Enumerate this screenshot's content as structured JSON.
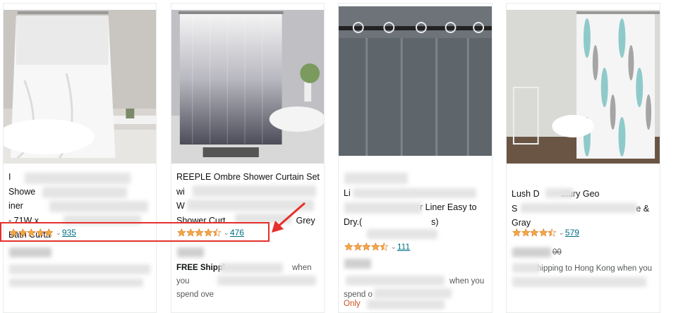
{
  "products": [
    {
      "title_lines": [
        "I",
        "Showe",
        "- 71W x",
        "Bath Curta"
      ],
      "title_suffix": "iner",
      "stars": 5.0,
      "review_count": "935"
    },
    {
      "title_lines": [
        "REEPLE Ombre Shower Curtain Set",
        "wi",
        "W",
        "Shower Curt"
      ],
      "title_suffix": "Grey",
      "stars": 4.5,
      "review_count": "476",
      "shipping_text": "FREE Shippi",
      "shipping_tail": "when you",
      "spend_text": "spend ove"
    },
    {
      "title_lines": [
        "",
        "Li",
        "",
        "Dry.("
      ],
      "title_extra": "r Liner Easy to",
      "title_end": "s)",
      "stars": 4.5,
      "review_count": "111",
      "shipping_tail": "when you",
      "spend_text": "spend o",
      "stock_text": "Only"
    },
    {
      "title_lines": [
        "Lush D",
        "S",
        "Gray"
      ],
      "title_extra": "utury Geo",
      "title_extra2": "e &",
      "stars": 4.5,
      "review_count": "579",
      "price_tail": "00",
      "shipping_text": "hipping to Hong Kong when you"
    }
  ],
  "colors": {
    "star": "#f3a847",
    "link": "#007185",
    "highlight": "#e5302b",
    "stock": "#c7511f"
  },
  "icons": [
    "star-icon",
    "chevron-down-icon",
    "arrow-icon"
  ]
}
